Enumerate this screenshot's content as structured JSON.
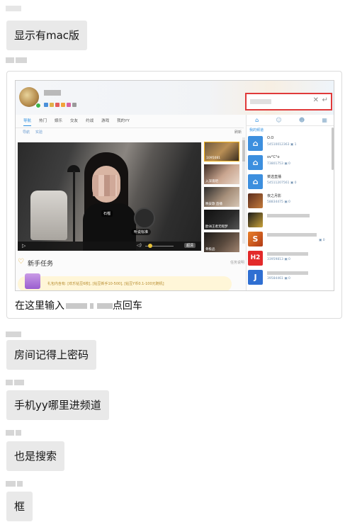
{
  "messages": [
    {
      "type": "text",
      "text": "显示有mac版"
    },
    {
      "type": "image",
      "caption_prefix": "在这里输入",
      "caption_suffix": "点回车",
      "screenshot": {
        "nav_tabs": [
          "导航",
          "热门",
          "娱乐",
          "交友",
          "约战",
          "游戏",
          "我的YY"
        ],
        "active_tab": "导航",
        "sub_tabs": [
          "导航",
          "实验"
        ],
        "sub_right": "刷新",
        "video_labels": [
          "石榴",
          "听说标准"
        ],
        "video_hd": "超清",
        "thumb_captions": [
          "1095081",
          "入深夜吧",
          "晚安歌 直播",
          "欧洲王者无暇梦",
          "骨极品"
        ],
        "new_task_title": "新手任务",
        "new_task_help": "任务说明",
        "promo_text": "礼包内含有: [欢乐钻豆6枚], [钻豆新手10-500], [钻豆Y币0.1-100元随机]",
        "right_panel_header": "我的频道",
        "channels": [
          {
            "icon": "home",
            "name": "O.O",
            "id": "54510012363",
            "count": "1"
          },
          {
            "icon": "home",
            "name": "ov°C°o",
            "id": "73801753",
            "count": "0"
          },
          {
            "icon": "home",
            "name": "菜选直播",
            "id": "54511207561",
            "count": "0"
          },
          {
            "icon": "avatar",
            "name": "夜之月影",
            "id": "58834475",
            "count": "0"
          },
          {
            "icon": "avatar",
            "name": "",
            "id": "",
            "count": ""
          },
          {
            "icon": "avatar",
            "name": "",
            "id": "",
            "count": "0"
          },
          {
            "icon": "h2",
            "name": "",
            "id": "33959813",
            "count": "0"
          },
          {
            "icon": "j",
            "name": "",
            "id": "39584461",
            "count": "0"
          }
        ]
      }
    },
    {
      "type": "text",
      "text": "房间记得上密码"
    },
    {
      "type": "text",
      "text": "手机yy哪里进频道"
    },
    {
      "type": "text",
      "text": "也是搜索"
    },
    {
      "type": "text",
      "text": "框"
    }
  ],
  "colors": {
    "bubble": "#e9e9e9",
    "highlight_border": "#e03a3a",
    "accent_blue": "#2d8fe0"
  }
}
